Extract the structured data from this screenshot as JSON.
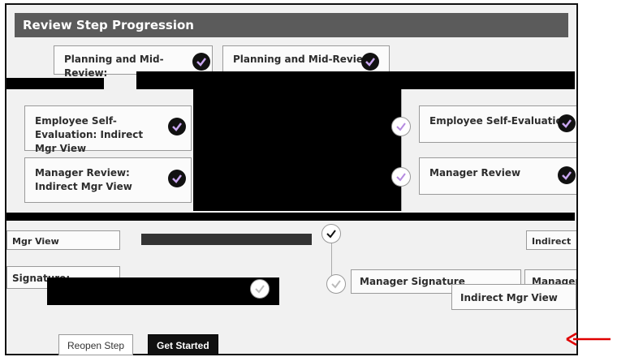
{
  "title": "Review Step Progression",
  "cards": [
    {
      "label": "Planning and Mid-Review:"
    },
    {
      "label": "Planning and Mid-Review:"
    },
    {
      "label": "Employee Self-Evaluation: Indirect Mgr View"
    },
    {
      "label": "Manager Review: Indirect Mgr View"
    },
    {
      "label": "Employee Self-Evaluation"
    },
    {
      "label": "Manager Review"
    },
    {
      "label": "Mgr View"
    },
    {
      "label": "Signature:"
    },
    {
      "label": "Manager Signature"
    },
    {
      "label": "Indirect Mgr View"
    },
    {
      "label": "Manager"
    },
    {
      "label": "Indirect"
    }
  ],
  "buttons": {
    "reopen": "Reopen Step",
    "start": "Get Started"
  },
  "colors": {
    "header": "#5b5b5b",
    "badge": "#111111",
    "check": "#9d4edd",
    "arrow": "#e00000"
  }
}
